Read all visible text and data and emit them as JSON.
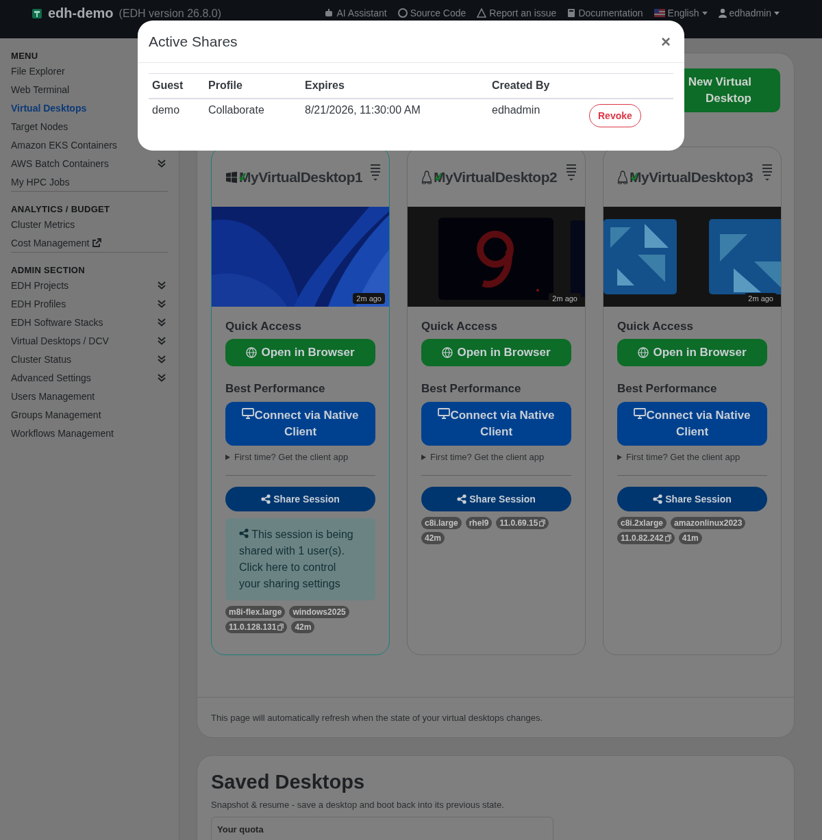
{
  "navbar": {
    "brand": "edh-demo",
    "version": "(EDH version 26.8.0)",
    "links": [
      "AI Assistant",
      "Source Code",
      "Report an issue",
      "Documentation"
    ],
    "language": "English",
    "user": "edhadmin"
  },
  "sidebar": {
    "sections": [
      {
        "title": "MENU",
        "items": [
          {
            "label": "File Explorer",
            "selected": false,
            "external": false
          },
          {
            "label": "Web Terminal",
            "selected": false,
            "external": false
          },
          {
            "label": "Virtual Desktops",
            "selected": true,
            "external": false
          },
          {
            "label": "Target Nodes",
            "selected": false,
            "external": false
          },
          {
            "label": "Amazon EKS Containers",
            "selected": false,
            "external": false
          },
          {
            "label": "AWS Batch Containers",
            "selected": false,
            "expandable": true,
            "external": false
          },
          {
            "label": "My HPC Jobs",
            "selected": false,
            "expandable": false,
            "external": false
          }
        ]
      },
      {
        "title": "ANALYTICS / BUDGET",
        "items": [
          {
            "label": "Cluster Metrics",
            "selected": false,
            "expandable": false,
            "external": false
          },
          {
            "label": "Cost Management",
            "selected": false,
            "expandable": false,
            "external": true
          }
        ]
      },
      {
        "title": "ADMIN SECTION",
        "items": [
          {
            "label": "EDH Projects",
            "selected": false,
            "expandable": true,
            "external": false
          },
          {
            "label": "EDH Profiles",
            "selected": false,
            "expandable": true,
            "external": false
          },
          {
            "label": "EDH Software Stacks",
            "selected": false,
            "expandable": true,
            "external": false
          },
          {
            "label": "Virtual Desktops / DCV",
            "selected": false,
            "expandable": true,
            "external": false
          },
          {
            "label": "Cluster Status",
            "selected": false,
            "expandable": true,
            "external": false
          },
          {
            "label": "Advanced Settings",
            "selected": false,
            "expandable": true,
            "external": false
          },
          {
            "label": "Users Management",
            "selected": false,
            "expandable": false,
            "external": false
          },
          {
            "label": "Groups Management",
            "selected": false,
            "expandable": false,
            "external": false
          },
          {
            "label": "Workflows Management",
            "selected": false,
            "expandable": false,
            "external": false
          }
        ]
      }
    ]
  },
  "desktops_panel": {
    "launch_button": "New Virtual Desktop",
    "cards": [
      {
        "title": "MyVirtualDesktop1",
        "kind": "windows",
        "selected": true,
        "running": true,
        "snapshot_age": "2m ago",
        "quick_access_label": "Quick Access",
        "browser_button": "Open in Browser",
        "performance_label": "Best Performance",
        "native_button": "Connect via Native Client",
        "client_hint": "First time? Get the client app",
        "share_button": "Share Session",
        "share_notice": "This session is being shared with 1 user(s). Click here to control your sharing settings",
        "tags": [
          {
            "label": "m8i-flex.large",
            "copyable": false
          },
          {
            "label": "windows2025",
            "copyable": false
          },
          {
            "label": "11.0.128.131",
            "copyable": true
          },
          {
            "label": "42m",
            "copyable": false
          }
        ]
      },
      {
        "title": "MyVirtualDesktop2",
        "kind": "linux",
        "selected": false,
        "running": true,
        "snapshot_age": "2m ago",
        "quick_access_label": "Quick Access",
        "browser_button": "Open in Browser",
        "performance_label": "Best Performance",
        "native_button": "Connect via Native Client",
        "client_hint": "First time? Get the client app",
        "share_button": "Share Session",
        "tags": [
          {
            "label": "c8i.large",
            "copyable": false
          },
          {
            "label": "rhel9",
            "copyable": false
          },
          {
            "label": "11.0.69.15",
            "copyable": true
          },
          {
            "label": "42m",
            "copyable": false
          }
        ]
      },
      {
        "title": "MyVirtualDesktop3",
        "kind": "linux",
        "selected": false,
        "running": true,
        "snapshot_age": "2m ago",
        "quick_access_label": "Quick Access",
        "browser_button": "Open in Browser",
        "performance_label": "Best Performance",
        "native_button": "Connect via Native Client",
        "client_hint": "First time? Get the client app",
        "share_button": "Share Session",
        "tags": [
          {
            "label": "c8i.2xlarge",
            "copyable": false
          },
          {
            "label": "amazonlinux2023",
            "copyable": false
          },
          {
            "label": "11.0.82.242",
            "copyable": true
          },
          {
            "label": "41m",
            "copyable": false
          }
        ]
      }
    ],
    "footer_note": "This page will automatically refresh when the state of your virtual desktops changes."
  },
  "saved_panel": {
    "title": "Saved Desktops",
    "subtitle": "Snapshot & resume - save a desktop and boot back into its previous state.",
    "quota_label": "Your quota"
  },
  "modal": {
    "title": "Active Shares",
    "close": "×",
    "columns": [
      "Guest",
      "Profile",
      "Expires",
      "Created By"
    ],
    "rows": [
      {
        "cells": [
          "demo",
          "Collaborate",
          "8/21/2026, 11:30:00 AM",
          "edhadmin"
        ],
        "action": "Revoke"
      }
    ]
  }
}
